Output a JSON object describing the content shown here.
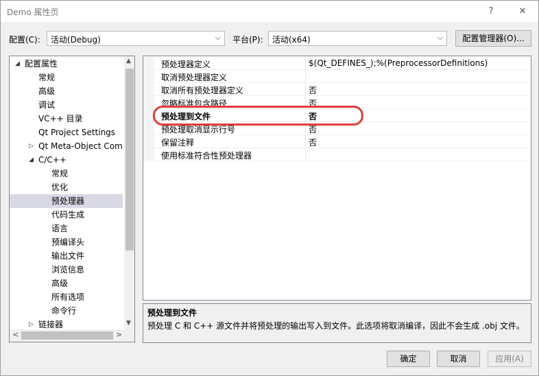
{
  "window": {
    "title": "Demo 属性页",
    "help_glyph": "?",
    "close_glyph": "✕"
  },
  "toolbar": {
    "config_label": "配置(C):",
    "config_value": "活动(Debug)",
    "platform_label": "平台(P):",
    "platform_value": "活动(x64)",
    "config_manager_label": "配置管理器(O)..."
  },
  "tree": {
    "items": [
      {
        "label": "配置属性",
        "expander": "◢"
      },
      {
        "label": "常规"
      },
      {
        "label": "高级"
      },
      {
        "label": "调试"
      },
      {
        "label": "VC++ 目录"
      },
      {
        "label": "Qt Project Settings"
      },
      {
        "label": "Qt Meta-Object Com",
        "expander": "▷"
      },
      {
        "label": "C/C++",
        "expander": "◢"
      },
      {
        "label": "常规"
      },
      {
        "label": "优化"
      },
      {
        "label": "预处理器"
      },
      {
        "label": "代码生成"
      },
      {
        "label": "语言"
      },
      {
        "label": "预编译头"
      },
      {
        "label": "输出文件"
      },
      {
        "label": "浏览信息"
      },
      {
        "label": "高级"
      },
      {
        "label": "所有选项"
      },
      {
        "label": "命令行"
      },
      {
        "label": "链接器",
        "expander": "▷"
      }
    ],
    "scroll_up": "▲",
    "scroll_down": "▼",
    "scroll_left": "<",
    "scroll_right": ">"
  },
  "properties": [
    {
      "name": "预处理器定义",
      "value": "$(Qt_DEFINES_);%(PreprocessorDefinitions)"
    },
    {
      "name": "取消预处理器定义",
      "value": ""
    },
    {
      "name": "取消所有预处理器定义",
      "value": "否"
    },
    {
      "name": "忽略标准包含路径",
      "value": "否"
    },
    {
      "name": "预处理到文件",
      "value": "否"
    },
    {
      "name": "预处理取消显示行号",
      "value": "否"
    },
    {
      "name": "保留注释",
      "value": "否"
    },
    {
      "name": "使用标准符合性预处理器",
      "value": ""
    }
  ],
  "description": {
    "title": "预处理到文件",
    "text": "预处理 C 和 C++ 源文件并将预处理的输出写入到文件。此选项将取消编译，因此不会生成 .obj 文件。"
  },
  "buttons": {
    "ok": "确定",
    "cancel": "取消",
    "apply": "应用(A)"
  },
  "colors": {
    "highlight": "#e23b3b",
    "selection": "#d9d9e6"
  }
}
